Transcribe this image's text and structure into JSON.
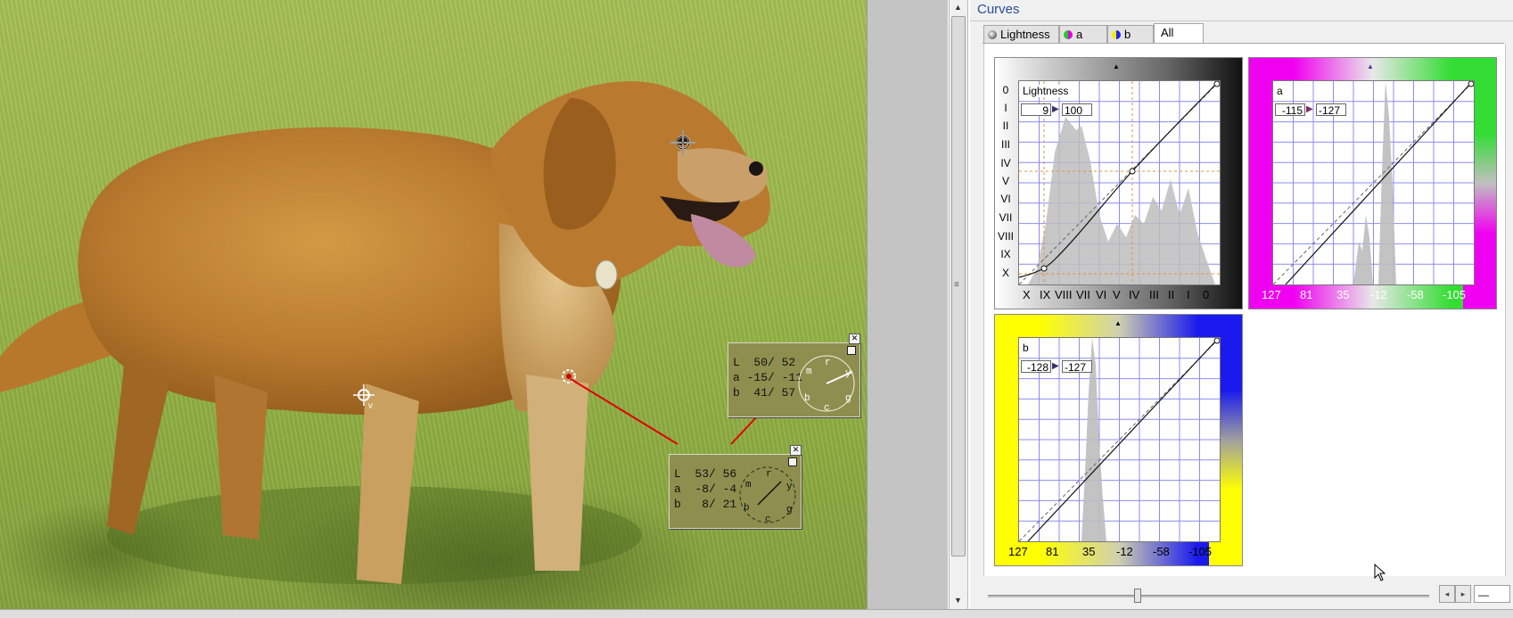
{
  "colors": {
    "title": "#2a4d9a",
    "info_panel": "#8e8f4f",
    "link_line": "#e00000",
    "grid": "#8c8cf0"
  },
  "probes": [
    {
      "name": "probe-1",
      "L": "50/ 52",
      "a": "-15/ -11",
      "b": "41/ 57",
      "dial_labels": [
        "m",
        "r",
        "y",
        "b",
        "c",
        "g"
      ]
    },
    {
      "name": "probe-2",
      "L": "53/ 56",
      "a": "-8/ -4",
      "b": "8/ 21",
      "dial_labels": [
        "m",
        "r",
        "y",
        "b",
        "c",
        "g"
      ]
    }
  ],
  "probe_labels": {
    "L": "L",
    "a": "a",
    "b": "b"
  },
  "curves": {
    "title": "Curves",
    "tabs": [
      {
        "label": "Lightness",
        "icon": "lightness-icon"
      },
      {
        "label": "a",
        "icon": "a-channel-icon"
      },
      {
        "label": "b",
        "icon": "b-channel-icon"
      },
      {
        "label": "All",
        "active": true
      }
    ],
    "lightness": {
      "label": "Lightness",
      "input_value": "9",
      "output_value": "100",
      "y_ticks": [
        "0",
        "I",
        "II",
        "III",
        "IV",
        "V",
        "VI",
        "VII",
        "VIII",
        "IX",
        "X"
      ],
      "x_ticks": [
        "X",
        "IX",
        "VIII",
        "VII",
        "VI",
        "V",
        "IV",
        "III",
        "II",
        "I",
        "0"
      ]
    },
    "a": {
      "label": "a",
      "input_value": "-115",
      "output_value": "-127",
      "x_ticks": [
        "127",
        "81",
        "35",
        "-12",
        "-58",
        "-105"
      ]
    },
    "b": {
      "label": "b",
      "input_value": "-128",
      "output_value": "-127",
      "x_ticks": [
        "127",
        "81",
        "35",
        "-12",
        "-58",
        "-105"
      ]
    }
  },
  "scroll": {
    "left_arrow": "◂",
    "right_arrow": "▸",
    "zoom_value": "—"
  }
}
